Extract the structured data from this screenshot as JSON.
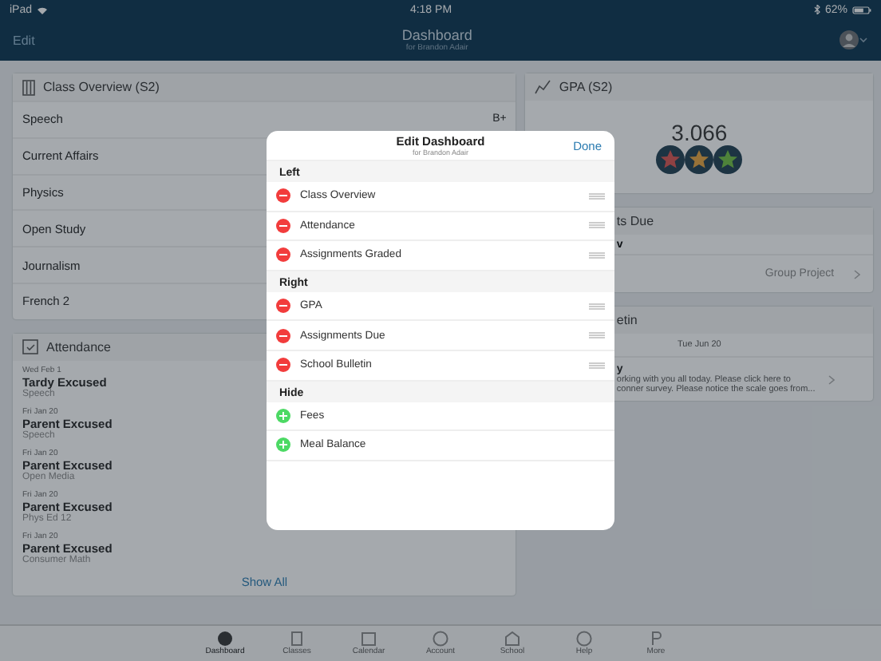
{
  "status_bar": {
    "device": "iPad",
    "time": "4:18 PM",
    "battery": "62%"
  },
  "nav": {
    "edit": "Edit",
    "title": "Dashboard",
    "subtitle": "for Brandon Adair"
  },
  "class_overview": {
    "title": "Class Overview (S2)",
    "classes": [
      {
        "name": "Speech",
        "grade": "B+"
      },
      {
        "name": "Current Affairs"
      },
      {
        "name": "Physics"
      },
      {
        "name": "Open Study"
      },
      {
        "name": "Journalism"
      },
      {
        "name": "French 2"
      }
    ]
  },
  "attendance": {
    "title": "Attendance",
    "entries": [
      {
        "date": "Wed Feb 1",
        "status": "Tardy Excused",
        "class": "Speech"
      },
      {
        "date": "Fri Jan 20",
        "status": "Parent Excused",
        "class": "Speech"
      },
      {
        "date": "Fri Jan 20",
        "status": "Parent Excused",
        "class": "Open Media"
      },
      {
        "date": "Fri Jan 20",
        "status": "Parent Excused",
        "class": "Phys Ed 12"
      },
      {
        "date": "Fri Jan 20",
        "status": "Parent Excused",
        "class": "Consumer Math"
      }
    ],
    "show_all": "Show All"
  },
  "gpa": {
    "title": "GPA (S2)",
    "value": "3.066"
  },
  "assignments_due": {
    "title": "ts Due",
    "day": "v",
    "item": "Group Project"
  },
  "bulletin": {
    "title": "etin",
    "date": "Tue Jun 20",
    "heading": "y",
    "lines": [
      "orking with you all today. Please click here to",
      "conner survey. Please notice the scale goes from..."
    ]
  },
  "modal": {
    "title": "Edit Dashboard",
    "subtitle": "for Brandon Adair",
    "done": "Done",
    "sections": [
      {
        "label": "Left",
        "items": [
          {
            "label": "Class Overview",
            "kind": "remove"
          },
          {
            "label": "Attendance",
            "kind": "remove"
          },
          {
            "label": "Assignments Graded",
            "kind": "remove"
          }
        ]
      },
      {
        "label": "Right",
        "items": [
          {
            "label": "GPA",
            "kind": "remove"
          },
          {
            "label": "Assignments Due",
            "kind": "remove"
          },
          {
            "label": "School Bulletin",
            "kind": "remove"
          }
        ]
      },
      {
        "label": "Hide",
        "items": [
          {
            "label": "Fees",
            "kind": "add"
          },
          {
            "label": "Meal Balance",
            "kind": "add"
          }
        ]
      }
    ]
  },
  "tab_bar": [
    {
      "label": "Dashboard",
      "selected": true
    },
    {
      "label": "Classes",
      "selected": false
    },
    {
      "label": "Calendar",
      "selected": false
    },
    {
      "label": "Account",
      "selected": false
    },
    {
      "label": "School",
      "selected": false
    },
    {
      "label": "Help",
      "selected": false
    },
    {
      "label": "More",
      "selected": false
    }
  ]
}
